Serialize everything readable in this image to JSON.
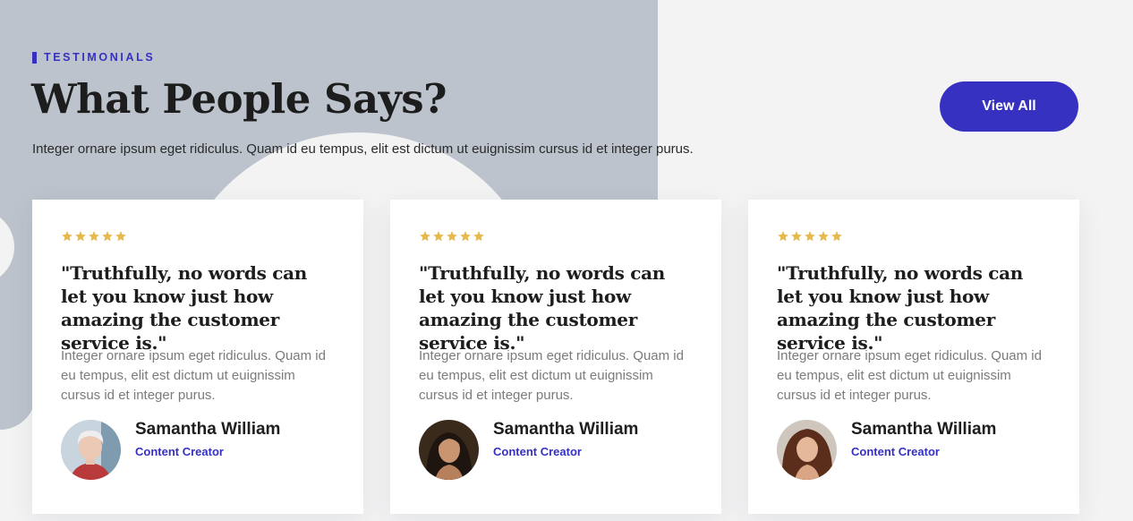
{
  "section": {
    "eyebrow": "TESTIMONIALS",
    "title": "What People Says?",
    "subtitle": "Integer ornare ipsum eget ridiculus. Quam id eu tempus, elit est dictum ut euignissim cursus id et integer purus.",
    "view_all_label": "View All"
  },
  "colors": {
    "accent": "#3631c0",
    "star": "#e5b94a",
    "grey_block": "#bcc3cc",
    "background": "#f3f3f4"
  },
  "testimonials": [
    {
      "rating": 5,
      "quote": "\"Truthfully, no words can let you know just how amazing the customer service is.\"",
      "text": "Integer ornare ipsum eget ridiculus. Quam id eu tempus, elit est dictum ut euignissim cursus id et integer purus.",
      "name": "Samantha William",
      "role": "Content Creator",
      "avatar_icon": "avatar-elderly-woman"
    },
    {
      "rating": 5,
      "quote": "\"Truthfully, no words can let you know just how amazing the customer service is.\"",
      "text": "Integer ornare ipsum eget ridiculus. Quam id eu tempus, elit est dictum ut euignissim cursus id et integer purus.",
      "name": "Samantha William",
      "role": "Content Creator",
      "avatar_icon": "avatar-woman-dark-hair"
    },
    {
      "rating": 5,
      "quote": "\"Truthfully, no words can let you know just how amazing the customer service is.\"",
      "text": "Integer ornare ipsum eget ridiculus. Quam id eu tempus, elit est dictum ut euignissim cursus id et integer purus.",
      "name": "Samantha William",
      "role": "Content Creator",
      "avatar_icon": "avatar-woman-curly-hair"
    }
  ]
}
